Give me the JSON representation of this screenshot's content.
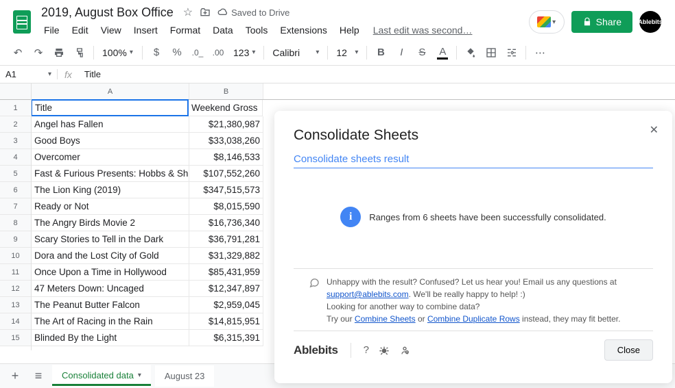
{
  "header": {
    "doc_title": "2019, August Box Office",
    "saved_status": "Saved to Drive",
    "menus": [
      "File",
      "Edit",
      "View",
      "Insert",
      "Format",
      "Data",
      "Tools",
      "Extensions",
      "Help"
    ],
    "last_edit": "Last edit was second…",
    "share_label": "Share",
    "avatar_label": "Ablebits"
  },
  "toolbar": {
    "zoom": "100%",
    "font_name": "Calibri",
    "font_size": "12"
  },
  "formula_bar": {
    "name_box": "A1",
    "fx": "fx",
    "content": "Title"
  },
  "columns": [
    "A",
    "B"
  ],
  "rows": [
    {
      "n": "1",
      "a": "Title",
      "b": "Weekend Gross"
    },
    {
      "n": "2",
      "a": "Angel has Fallen",
      "b": "$21,380,987"
    },
    {
      "n": "3",
      "a": "Good Boys",
      "b": "$33,038,260"
    },
    {
      "n": "4",
      "a": "Overcomer",
      "b": "$8,146,533"
    },
    {
      "n": "5",
      "a": "Fast & Furious Presents: Hobbs & Shaw",
      "b": "$107,552,260"
    },
    {
      "n": "6",
      "a": "The Lion King (2019)",
      "b": "$347,515,573"
    },
    {
      "n": "7",
      "a": "Ready or Not",
      "b": "$8,015,590"
    },
    {
      "n": "8",
      "a": "The Angry Birds Movie 2",
      "b": "$16,736,340"
    },
    {
      "n": "9",
      "a": "Scary Stories to Tell in the Dark",
      "b": "$36,791,281"
    },
    {
      "n": "10",
      "a": "Dora and the Lost City of Gold",
      "b": "$31,329,882"
    },
    {
      "n": "11",
      "a": "Once Upon a Time in Hollywood",
      "b": "$85,431,959"
    },
    {
      "n": "12",
      "a": "47 Meters Down: Uncaged",
      "b": "$12,347,897"
    },
    {
      "n": "13",
      "a": "The Peanut Butter Falcon",
      "b": "$2,959,045"
    },
    {
      "n": "14",
      "a": "The Art of Racing in the Rain",
      "b": "$14,815,951"
    },
    {
      "n": "15",
      "a": "Blinded By the Light",
      "b": "$6,315,391"
    }
  ],
  "sheet_tabs": {
    "add": "+",
    "active": "Consolidated data",
    "other": "August 23"
  },
  "panel": {
    "title": "Consolidate Sheets",
    "subtitle": "Consolidate sheets result",
    "message": "Ranges from 6 sheets have been successfully consolidated.",
    "help1_a": "Unhappy with the result? Confused? Let us hear you! Email us any questions at ",
    "help1_link": "support@ablebits.com",
    "help1_b": ". We'll be really happy to help! :)",
    "help2_a": "Looking for another way to combine data?",
    "help2_b": "Try our ",
    "help2_link1": "Combine Sheets",
    "help2_c": " or ",
    "help2_link2": "Combine Duplicate Rows",
    "help2_d": " instead, they may fit better.",
    "brand": "Ablebits",
    "close": "Close"
  }
}
